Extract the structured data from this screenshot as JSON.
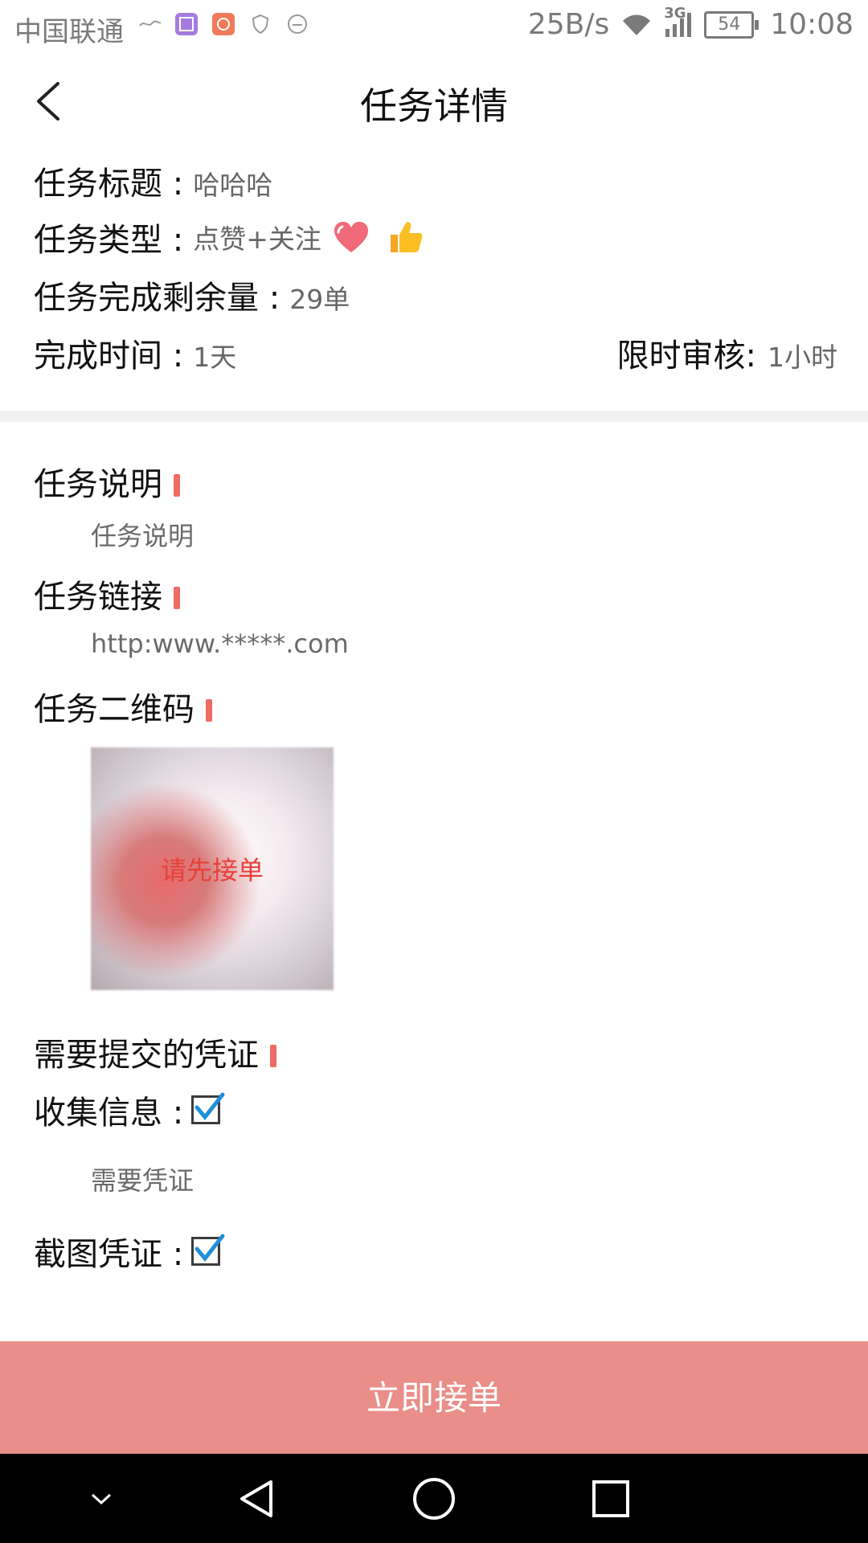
{
  "status_bar": {
    "carrier": "中国联通",
    "speed": "25B/s",
    "network": "3G",
    "battery": "54",
    "time": "10:08"
  },
  "header": {
    "title": "任务详情",
    "back_icon": "chevron-left-icon"
  },
  "task_info": {
    "title_label": "任务标题 :",
    "title_value": "哈哈哈",
    "type_label": "任务类型 :",
    "type_value": "点赞+关注",
    "type_icons": [
      "heart-icon",
      "thumbs-up-icon"
    ],
    "remaining_label": "任务完成剩余量 :",
    "remaining_value": "29单",
    "time_label": "完成时间 :",
    "time_value": "1天",
    "review_label": "限时审核:",
    "review_value": "1小时"
  },
  "sections": {
    "description_title": "任务说明",
    "description_body": "任务说明",
    "link_title": "任务链接",
    "link_body": "http:www.*****.com",
    "qr_title": "任务二维码",
    "qr_overlay": "请先接单",
    "proof_title": "需要提交的凭证"
  },
  "proofs": {
    "collect_label": "收集信息 :",
    "collect_checked": true,
    "collect_note": "需要凭证",
    "screenshot_label": "截图凭证 :",
    "screenshot_checked": true
  },
  "actions": {
    "accept_label": "立即接单"
  },
  "colors": {
    "accent_red": "#ef6b66",
    "button_bg": "#e98e89",
    "check_blue": "#1e8fd9"
  }
}
